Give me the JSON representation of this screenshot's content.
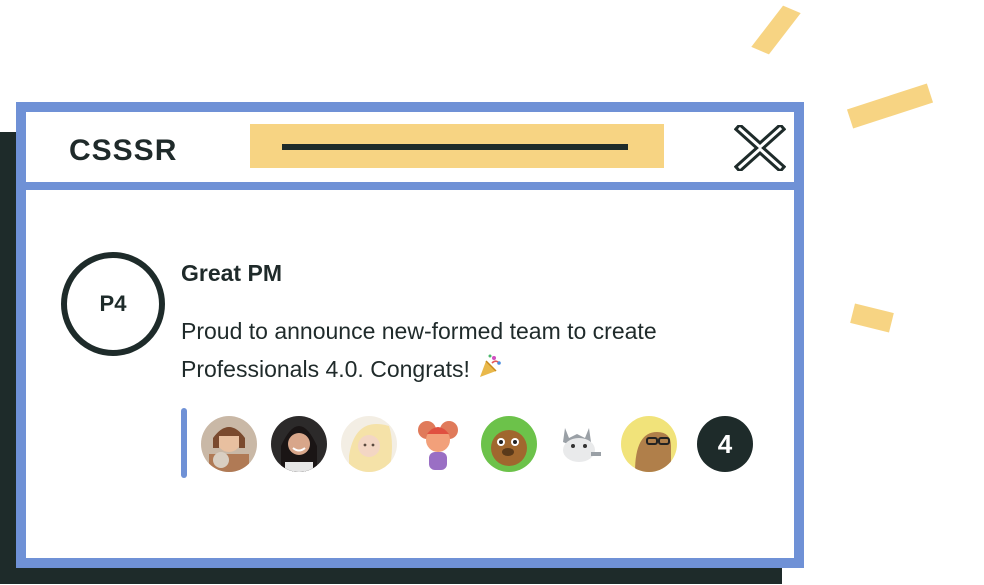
{
  "window": {
    "logo": "CSSSR",
    "close_icon": "close-x-icon"
  },
  "post": {
    "badge": "P4",
    "title": "Great PM",
    "text": "Proud to announce new-formed team to create Professionals 4.0. Congrats!",
    "emoji_icon": "party-popper-icon"
  },
  "reactions": {
    "avatars": [
      "avatar-woman-with-cat",
      "avatar-smiling-woman",
      "avatar-blonde-woman",
      "avatar-cartoon-mouse",
      "avatar-cartoon-beaver",
      "avatar-cartoon-cat",
      "avatar-cartoon-bear-glasses"
    ],
    "more_count": "4"
  },
  "colors": {
    "dark": "#1e2b2a",
    "blue": "#6f91d6",
    "yellow": "#f7d483"
  }
}
